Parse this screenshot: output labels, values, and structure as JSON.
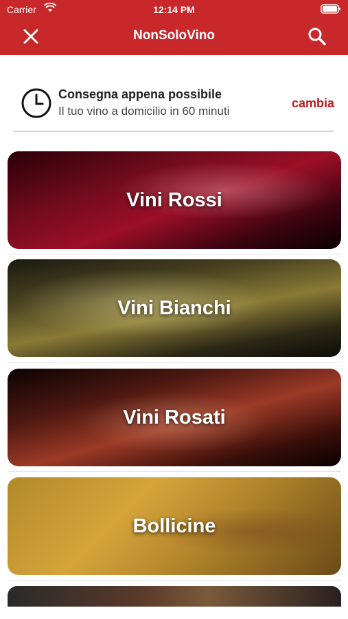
{
  "status_bar": {
    "carrier": "Carrier",
    "time": "12:14 PM"
  },
  "header": {
    "title": "NonSoloVino",
    "close_icon": "close-icon",
    "search_icon": "search-icon",
    "color": "#c8282a"
  },
  "delivery": {
    "title": "Consegna appena possibile",
    "subtitle": "Il tuo vino a domicilio in 60 minuti",
    "change_label": "cambia",
    "icon": "clock-icon"
  },
  "categories": [
    {
      "label": "Vini Rossi"
    },
    {
      "label": "Vini Bianchi"
    },
    {
      "label": "Vini Rosati"
    },
    {
      "label": "Bollicine"
    }
  ]
}
